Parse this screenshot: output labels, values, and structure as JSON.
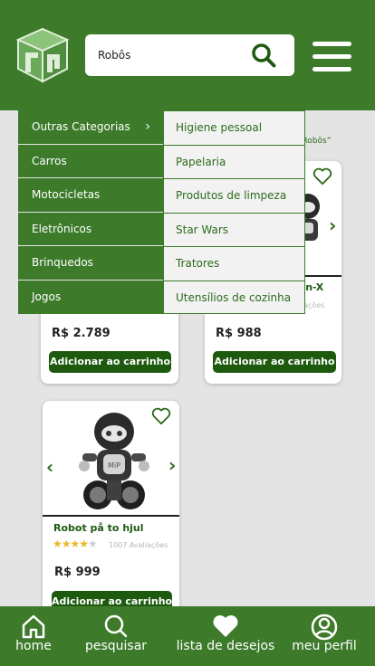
{
  "header": {
    "search": {
      "value": "Robôs",
      "placeholder": ""
    }
  },
  "results_note": "ra “Robôs”",
  "categories": [
    {
      "label": "Outras Categorias",
      "has_submenu": true
    },
    {
      "label": "Carros"
    },
    {
      "label": "Motocicletas"
    },
    {
      "label": "Eletrônicos"
    },
    {
      "label": "Brinquedos"
    },
    {
      "label": "Jogos"
    }
  ],
  "subcategories": [
    {
      "label": "Higiene pessoal"
    },
    {
      "label": "Papelaria"
    },
    {
      "label": "Produtos de limpeza"
    },
    {
      "label": "Star Wars"
    },
    {
      "label": "Tratores"
    },
    {
      "label": "Utensílios de cozinha"
    }
  ],
  "products": [
    {
      "name": "",
      "price": "R$ 2.789",
      "button": "Adicionar ao carrinho"
    },
    {
      "name": "ien-X",
      "reviews": "ações",
      "price": "R$ 988",
      "button": "Adicionar ao carrinho"
    },
    {
      "name": "Robot på to hjul",
      "rating": 4,
      "reviews": "1007 Avaliações",
      "price": "R$ 999",
      "button": "Adicionar ao carrinho"
    }
  ],
  "bottom_nav": [
    {
      "label": "home",
      "icon": "home-icon"
    },
    {
      "label": "pesquisar",
      "icon": "search-icon"
    },
    {
      "label": "lista de desejos",
      "icon": "heart-icon"
    },
    {
      "label": "meu perfil",
      "icon": "user-icon"
    }
  ],
  "colors": {
    "brand_green": "#3d7b2b",
    "dark_green": "#1d5a0e",
    "star": "#e9b923"
  }
}
